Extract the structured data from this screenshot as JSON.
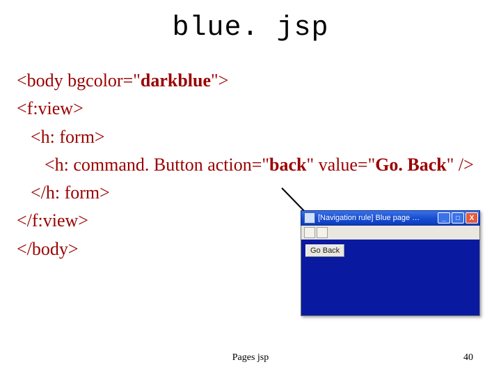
{
  "title": "blue. jsp",
  "code": {
    "line1_pre": "<body  bgcolor=\"",
    "line1_bold": "darkblue",
    "line1_post": "\">",
    "line2": "<f:view>",
    "line3": "<h: form>",
    "line4_pre": "<h: command. Button action=\"",
    "line4_b1": "back",
    "line4_mid": "\" value=\"",
    "line4_b2": "Go. Back",
    "line4_post": "\" />",
    "line5": "</h: form>",
    "line6": "</f:view>",
    "line7": "</body>"
  },
  "window": {
    "title": "[Navigation rule] Blue page …",
    "minimize": "_",
    "maximize": "□",
    "close": "X",
    "button_label": "Go Back"
  },
  "footer": {
    "center": "Pages jsp",
    "page_number": "40"
  }
}
